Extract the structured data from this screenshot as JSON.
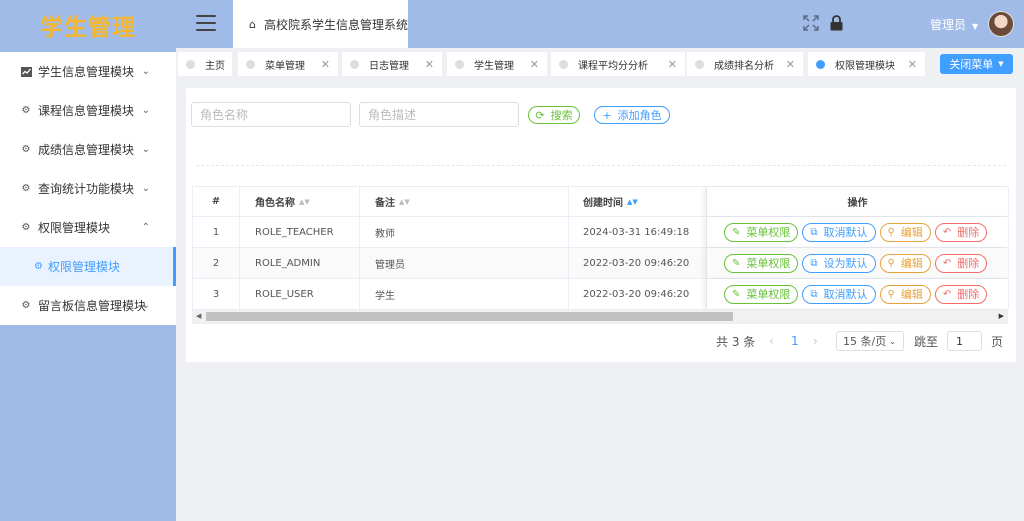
{
  "logo": "学生管理",
  "header": {
    "system_title": "高校院系学生信息管理系统",
    "user": "管理员"
  },
  "sidebar": {
    "items": [
      {
        "label": "学生信息管理模块",
        "icon": "chart-icon",
        "expanded": false
      },
      {
        "label": "课程信息管理模块",
        "icon": "gear-icon",
        "expanded": false
      },
      {
        "label": "成绩信息管理模块",
        "icon": "gear-icon",
        "expanded": false
      },
      {
        "label": "查询统计功能模块",
        "icon": "gear-icon",
        "expanded": false
      },
      {
        "label": "权限管理模块",
        "icon": "gear-icon",
        "expanded": true
      },
      {
        "label": "留言板信息管理模块",
        "icon": "gear-icon",
        "expanded": false
      }
    ],
    "sub_item": {
      "label": "权限管理模块",
      "icon": "gear-icon"
    }
  },
  "tabs": [
    {
      "label": "主页",
      "closable": false,
      "active": false
    },
    {
      "label": "菜单管理",
      "closable": true,
      "active": false
    },
    {
      "label": "日志管理",
      "closable": true,
      "active": false
    },
    {
      "label": "学生管理",
      "closable": true,
      "active": false
    },
    {
      "label": "课程平均分分析",
      "closable": true,
      "active": false
    },
    {
      "label": "成绩排名分析",
      "closable": true,
      "active": false
    },
    {
      "label": "权限管理模块",
      "closable": true,
      "active": true
    }
  ],
  "close_menu_label": "关闭菜单",
  "search": {
    "role_name_placeholder": "角色名称",
    "role_desc_placeholder": "角色描述",
    "search_label": "搜索",
    "add_label": "添加角色"
  },
  "table": {
    "headers": {
      "index": "#",
      "name": "角色名称",
      "desc": "备注",
      "time": "创建时间",
      "ops": "操作"
    },
    "rows": [
      {
        "index": "1",
        "name": "ROLE_TEACHER",
        "desc": "教师",
        "time": "2024-03-31 16:49:18",
        "menu": "菜单权限",
        "default": "取消默认",
        "edit": "编辑",
        "del": "删除"
      },
      {
        "index": "2",
        "name": "ROLE_ADMIN",
        "desc": "管理员",
        "time": "2022-03-20 09:46:20",
        "menu": "菜单权限",
        "default": "设为默认",
        "edit": "编辑",
        "del": "删除"
      },
      {
        "index": "3",
        "name": "ROLE_USER",
        "desc": "学生",
        "time": "2022-03-20 09:46:20",
        "menu": "菜单权限",
        "default": "取消默认",
        "edit": "编辑",
        "del": "删除"
      }
    ]
  },
  "pagination": {
    "total": "共 3 条",
    "current": "1",
    "page_size": "15 条/页",
    "goto_label": "跳至",
    "goto_value": "1",
    "page_suffix": "页"
  },
  "colors": {
    "sidebar_bg": "#a0bbe8",
    "accent": "#409eff",
    "logo": "#f6b730",
    "green": "#67c23a",
    "orange": "#e6a23c",
    "red": "#f56c6c"
  }
}
